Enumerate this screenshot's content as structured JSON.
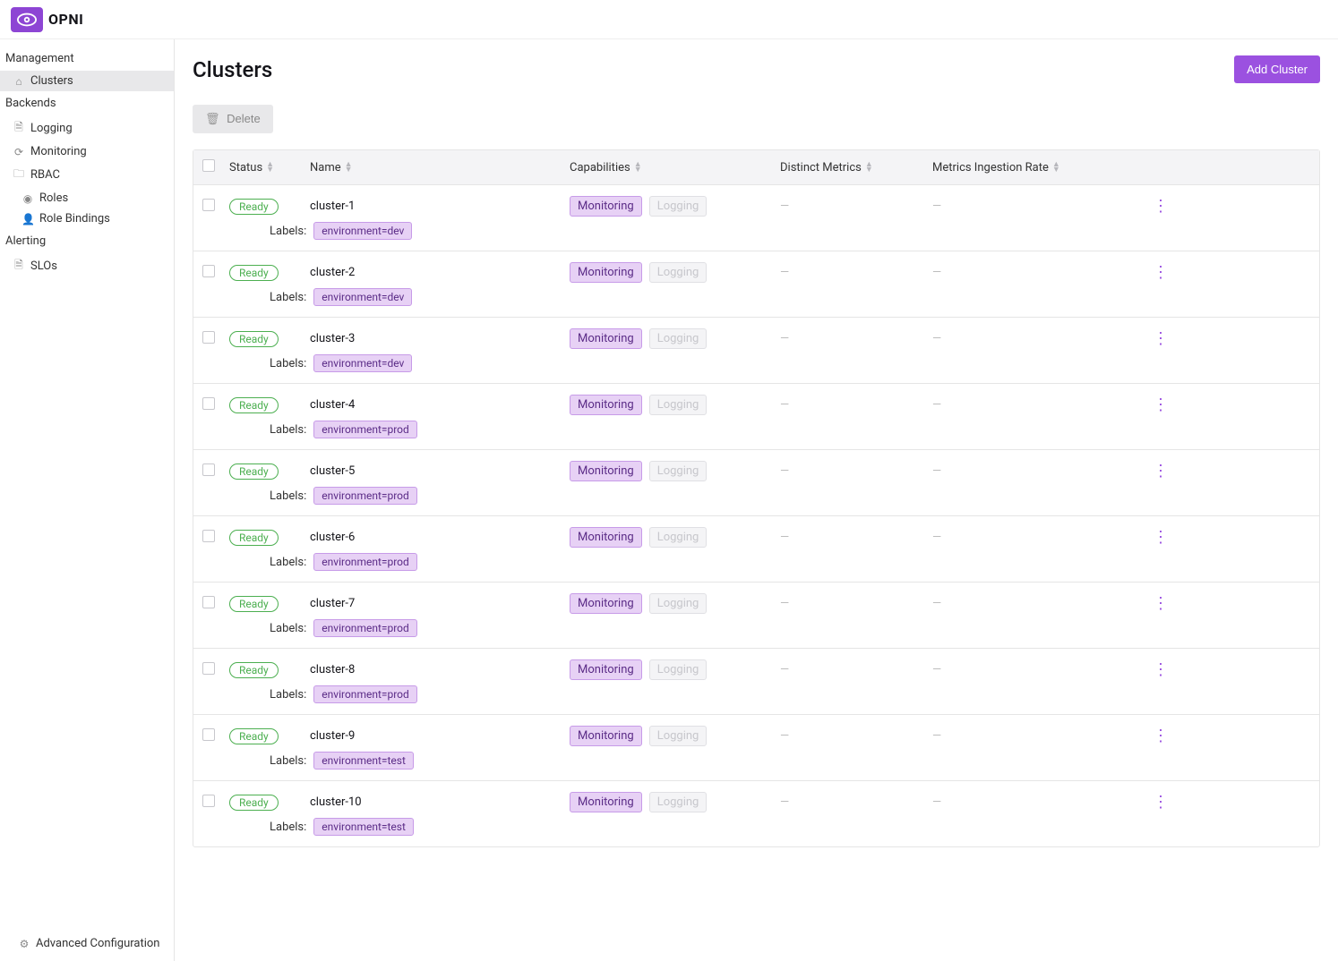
{
  "brand": {
    "name": "OPNI"
  },
  "sidebar": {
    "groups": [
      {
        "title": "Management",
        "items": [
          {
            "icon": "⌂",
            "label": "Clusters",
            "active": true
          }
        ]
      },
      {
        "title": "Backends",
        "items": [
          {
            "icon": "🗎",
            "label": "Logging"
          },
          {
            "icon": "⟳",
            "label": "Monitoring"
          },
          {
            "icon": "🗀",
            "label": "RBAC"
          },
          {
            "icon": "◉",
            "label": "Roles",
            "depth": 2
          },
          {
            "icon": "👤",
            "label": "Role Bindings",
            "depth": 2
          }
        ]
      },
      {
        "title": "Alerting",
        "items": [
          {
            "icon": "🗎",
            "label": "SLOs"
          }
        ]
      }
    ],
    "footer": {
      "icon": "⚙",
      "label": "Advanced Configuration"
    }
  },
  "page": {
    "title": "Clusters"
  },
  "buttons": {
    "add": "Add Cluster",
    "delete": "Delete",
    "deleteIcon": "🗑"
  },
  "table": {
    "headers": {
      "status": "Status",
      "name": "Name",
      "capabilities": "Capabilities",
      "distinct": "Distinct Metrics",
      "rate": "Metrics Ingestion Rate"
    },
    "labelsPrefix": "Labels:",
    "capOn": "Monitoring",
    "capOff": "Logging",
    "dash": "—",
    "statusReady": "Ready",
    "rows": [
      {
        "name": "cluster-1",
        "label": "environment=dev"
      },
      {
        "name": "cluster-2",
        "label": "environment=dev"
      },
      {
        "name": "cluster-3",
        "label": "environment=dev"
      },
      {
        "name": "cluster-4",
        "label": "environment=prod"
      },
      {
        "name": "cluster-5",
        "label": "environment=prod"
      },
      {
        "name": "cluster-6",
        "label": "environment=prod"
      },
      {
        "name": "cluster-7",
        "label": "environment=prod"
      },
      {
        "name": "cluster-8",
        "label": "environment=prod"
      },
      {
        "name": "cluster-9",
        "label": "environment=test"
      },
      {
        "name": "cluster-10",
        "label": "environment=test"
      }
    ]
  }
}
